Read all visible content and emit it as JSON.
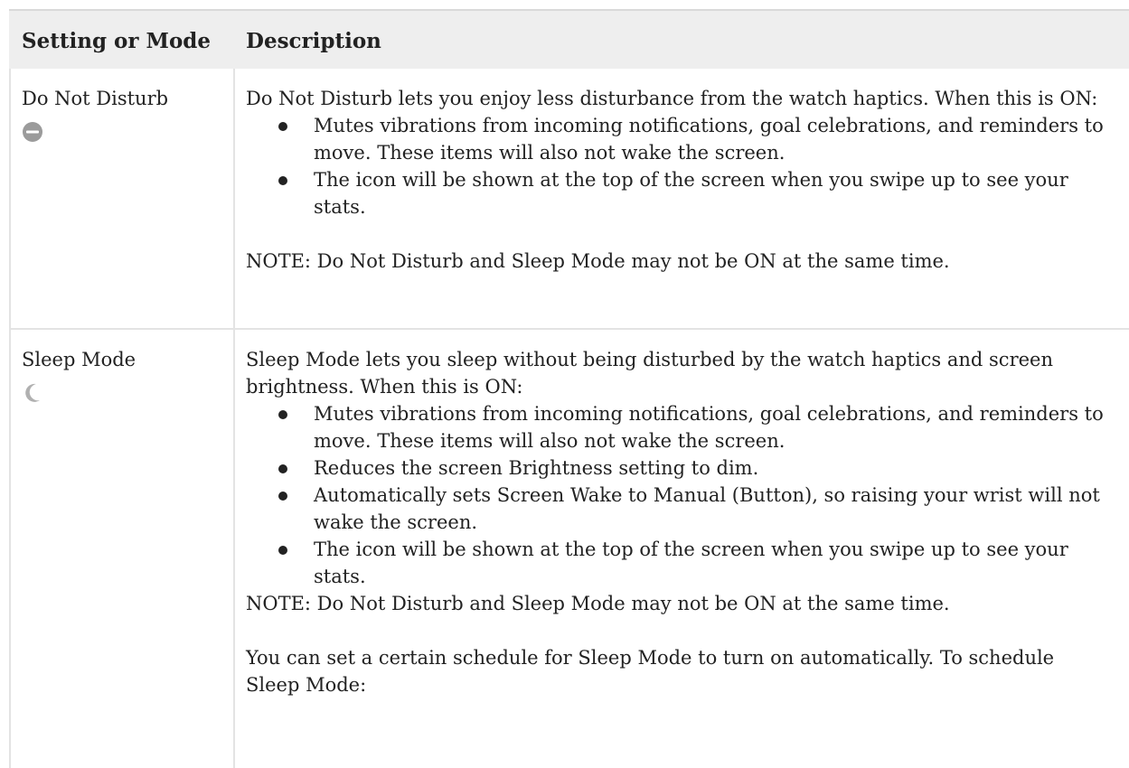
{
  "header": {
    "col1": "Setting or Mode",
    "col2": "Description"
  },
  "rows": [
    {
      "name": "Do Not Disturb",
      "icon": "do-not-disturb-icon",
      "intro": "Do Not Disturb lets you enjoy less disturbance from the watch haptics. When this is ON:",
      "bullets": [
        "Mutes vibrations from incoming notifications, goal celebrations, and reminders to move. These items will also not wake the screen.",
        "The icon will be shown at the top of the screen when you swipe up to see your stats."
      ],
      "note": "NOTE: Do Not Disturb and Sleep Mode may not be ON at the same time."
    },
    {
      "name": "Sleep Mode",
      "icon": "moon-icon",
      "intro": "Sleep Mode lets you sleep without being disturbed by the watch haptics and screen brightness. When this is ON:",
      "bullets": [
        "Mutes vibrations from incoming notifications, goal celebrations, and reminders to move. These items will also not wake the screen.",
        "Reduces the screen Brightness setting to dim.",
        "Automatically sets Screen Wake to Manual (Button), so raising your wrist will not wake the screen.",
        "The icon will be shown at the top of the screen when you swipe up to see your stats."
      ],
      "note": "NOTE: Do Not Disturb and Sleep Mode may not be ON at the same time.",
      "extra": "You can set a certain schedule for Sleep Mode to turn on automatically. To schedule Sleep Mode:"
    }
  ],
  "colors": {
    "header_bg": "#eeeeee",
    "border": "#e3e3e3",
    "icon_gray": "#9b9b9b"
  }
}
